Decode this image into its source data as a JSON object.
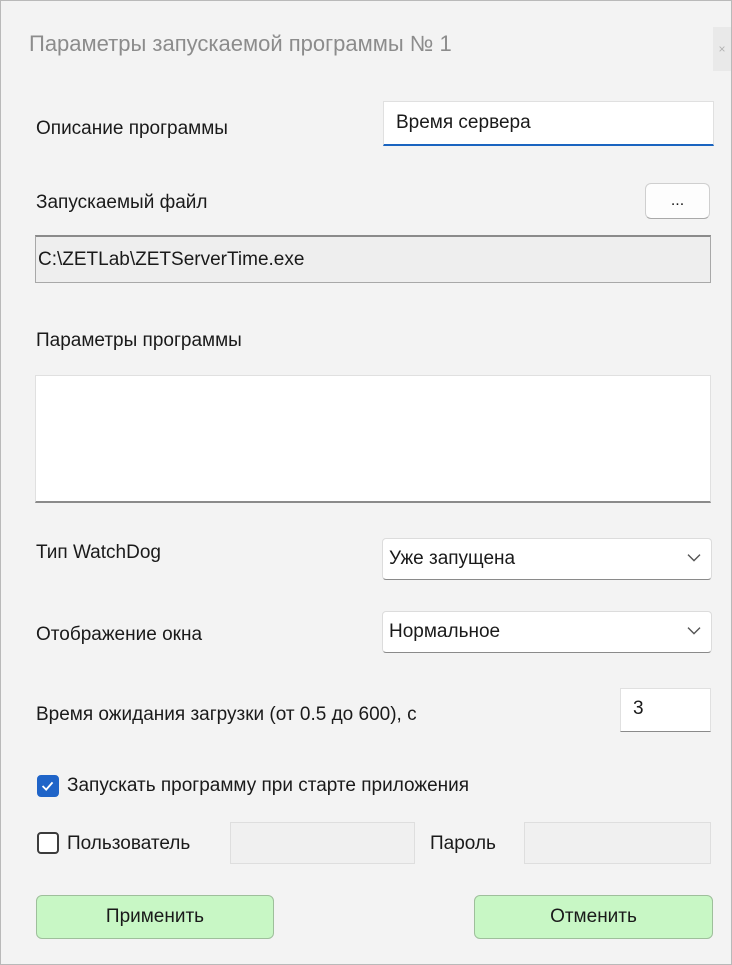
{
  "window": {
    "title": "Параметры запускаемой программы № 1",
    "close_glyph": "×"
  },
  "description": {
    "label": "Описание программы",
    "value": "Время сервера"
  },
  "exe": {
    "label": "Запускаемый файл",
    "browse_label": "...",
    "path": "C:\\ZETLab\\ZETServerTime.exe"
  },
  "params": {
    "label": "Параметры программы",
    "value": ""
  },
  "watchdog": {
    "label": "Тип WatchDog",
    "selected": "Уже запущена"
  },
  "window_mode": {
    "label": "Отображение окна",
    "selected": "Нормальное"
  },
  "timeout": {
    "label": "Время ожидания загрузки (от 0.5 до 600), с",
    "value": "3"
  },
  "autostart": {
    "label": "Запускать программу при старте приложения",
    "checked": true
  },
  "user": {
    "label": "Пользователь",
    "checked": false,
    "value": "",
    "password_label": "Пароль",
    "password_value": ""
  },
  "buttons": {
    "apply": "Применить",
    "cancel": "Отменить"
  },
  "colors": {
    "accent": "#1f64c8",
    "button_green": "#c8f7c5"
  }
}
